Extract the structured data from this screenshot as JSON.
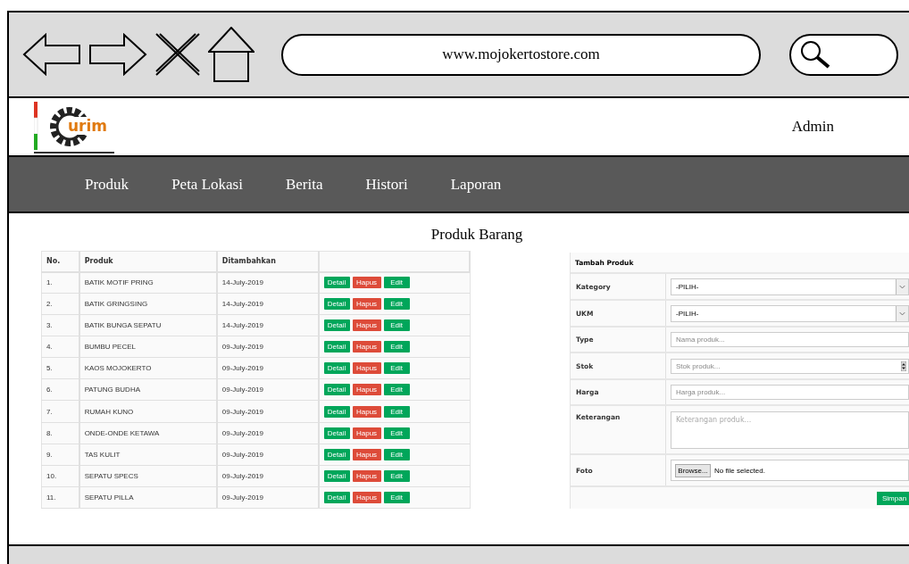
{
  "browser": {
    "url": "www.mojokertostore.com"
  },
  "header": {
    "logo_text": "urim",
    "user": "Admin"
  },
  "nav": [
    "Produk",
    "Peta Lokasi",
    "Berita",
    "Histori",
    "Laporan"
  ],
  "page_title": "Produk Barang",
  "table": {
    "columns": [
      "No.",
      "Produk",
      "Ditambahkan"
    ],
    "rows": [
      {
        "no": "1.",
        "produk": "BATIK MOTIF PRING",
        "date": "14-July-2019",
        "actions": [
          {
            "label": "Detail",
            "kind": "success"
          },
          {
            "label": "Hapus",
            "kind": "danger"
          },
          {
            "label": "Edit",
            "kind": "success"
          }
        ]
      },
      {
        "no": "2.",
        "produk": "BATIK GRINGSING",
        "date": "14-July-2019",
        "actions": [
          {
            "label": "Detail",
            "kind": "success"
          },
          {
            "label": "Hapus",
            "kind": "danger"
          },
          {
            "label": "Edit",
            "kind": "success"
          }
        ]
      },
      {
        "no": "3.",
        "produk": "BATIK BUNGA SEPATU",
        "date": "14-July-2019",
        "actions": [
          {
            "label": "Detail",
            "kind": "success"
          },
          {
            "label": "Hapus",
            "kind": "danger"
          },
          {
            "label": "Edit",
            "kind": "success"
          }
        ]
      },
      {
        "no": "4.",
        "produk": "BUMBU PECEL",
        "date": "09-July-2019",
        "actions": [
          {
            "label": "Detail",
            "kind": "success"
          },
          {
            "label": "Hapus",
            "kind": "danger"
          },
          {
            "label": "Edit",
            "kind": "success"
          }
        ]
      },
      {
        "no": "5.",
        "produk": "KAOS MOJOKERTO",
        "date": "09-July-2019",
        "actions": [
          {
            "label": "Detail",
            "kind": "success"
          },
          {
            "label": "Hapus",
            "kind": "danger"
          },
          {
            "label": "Edit",
            "kind": "success"
          }
        ]
      },
      {
        "no": "6.",
        "produk": "PATUNG BUDHA",
        "date": "09-July-2019",
        "actions": [
          {
            "label": "Detail",
            "kind": "success"
          },
          {
            "label": "Hapus",
            "kind": "danger"
          },
          {
            "label": "Edit",
            "kind": "success"
          }
        ]
      },
      {
        "no": "7.",
        "produk": "RUMAH KUNO",
        "date": "09-July-2019",
        "actions": [
          {
            "label": "Detail",
            "kind": "success"
          },
          {
            "label": "Hapus",
            "kind": "danger"
          },
          {
            "label": "Edit",
            "kind": "success"
          }
        ]
      },
      {
        "no": "8.",
        "produk": "ONDE-ONDE KETAWA",
        "date": "09-July-2019",
        "actions": [
          {
            "label": "Detail",
            "kind": "success"
          },
          {
            "label": "Hapus",
            "kind": "danger"
          },
          {
            "label": "Edit",
            "kind": "success"
          }
        ]
      },
      {
        "no": "9.",
        "produk": "TAS KULIT",
        "date": "09-July-2019",
        "actions": [
          {
            "label": "Detail",
            "kind": "success"
          },
          {
            "label": "Hapus",
            "kind": "danger"
          },
          {
            "label": "Edit",
            "kind": "success"
          }
        ]
      },
      {
        "no": "10.",
        "produk": "SEPATU SPECS",
        "date": "09-July-2019",
        "actions": [
          {
            "label": "Detail",
            "kind": "success"
          },
          {
            "label": "Hapus",
            "kind": "danger"
          },
          {
            "label": "Edit",
            "kind": "success"
          }
        ]
      },
      {
        "no": "11.",
        "produk": "SEPATU PILLA",
        "date": "09-July-2019",
        "actions": [
          {
            "label": "Detail",
            "kind": "success"
          },
          {
            "label": "Hapus",
            "kind": "danger"
          },
          {
            "label": "Edit",
            "kind": "success"
          }
        ]
      }
    ]
  },
  "form": {
    "title": "Tambah Produk",
    "fields": [
      {
        "label": "Kategory",
        "kind": "select",
        "value": "-PILIH-"
      },
      {
        "label": "UKM",
        "kind": "select",
        "value": "-PILIH-"
      },
      {
        "label": "Type",
        "kind": "text",
        "placeholder": "Nama produk..."
      },
      {
        "label": "Stok",
        "kind": "number",
        "placeholder": "Stok produk..."
      },
      {
        "label": "Harga",
        "kind": "text",
        "placeholder": "Harga produk..."
      },
      {
        "label": "Keterangan",
        "kind": "textarea",
        "placeholder": "Keterangan produk..."
      },
      {
        "label": "Foto",
        "kind": "file",
        "button": "Browse...",
        "status": "No file selected."
      }
    ],
    "submit": "Simpan"
  }
}
